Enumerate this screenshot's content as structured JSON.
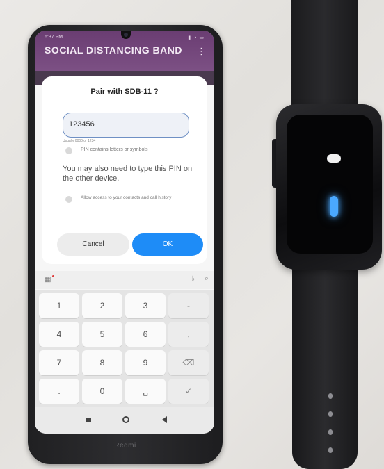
{
  "phone": {
    "status_time": "6:37 PM",
    "status_icons": "▮ ◔ ▭",
    "app_title": "SOCIAL DISTANCING BAND",
    "menu_icon": "overflow-menu-icon",
    "dialog": {
      "title": "Pair with SDB-11 ?",
      "pin_value": "123456",
      "pin_hint": "Usually 0000 or 1234",
      "pin_letters_label": "PIN contains letters or symbols",
      "info_text": "You may also need to type this PIN on the other device.",
      "contacts_label": "Allow access to your contacts and call history",
      "cancel_label": "Cancel",
      "ok_label": "OK"
    },
    "keyboard": {
      "keys": [
        [
          "1",
          "2",
          "3",
          "-"
        ],
        [
          "4",
          "5",
          "6",
          ","
        ],
        [
          "7",
          "8",
          "9",
          "⌫"
        ],
        [
          ".",
          "0",
          "␣",
          "✓"
        ]
      ]
    },
    "brand": "Redmi"
  },
  "colors": {
    "app_bar": "#6a3d72",
    "ok_button": "#1e8cf7",
    "watch_led": "#4aa8ff"
  }
}
